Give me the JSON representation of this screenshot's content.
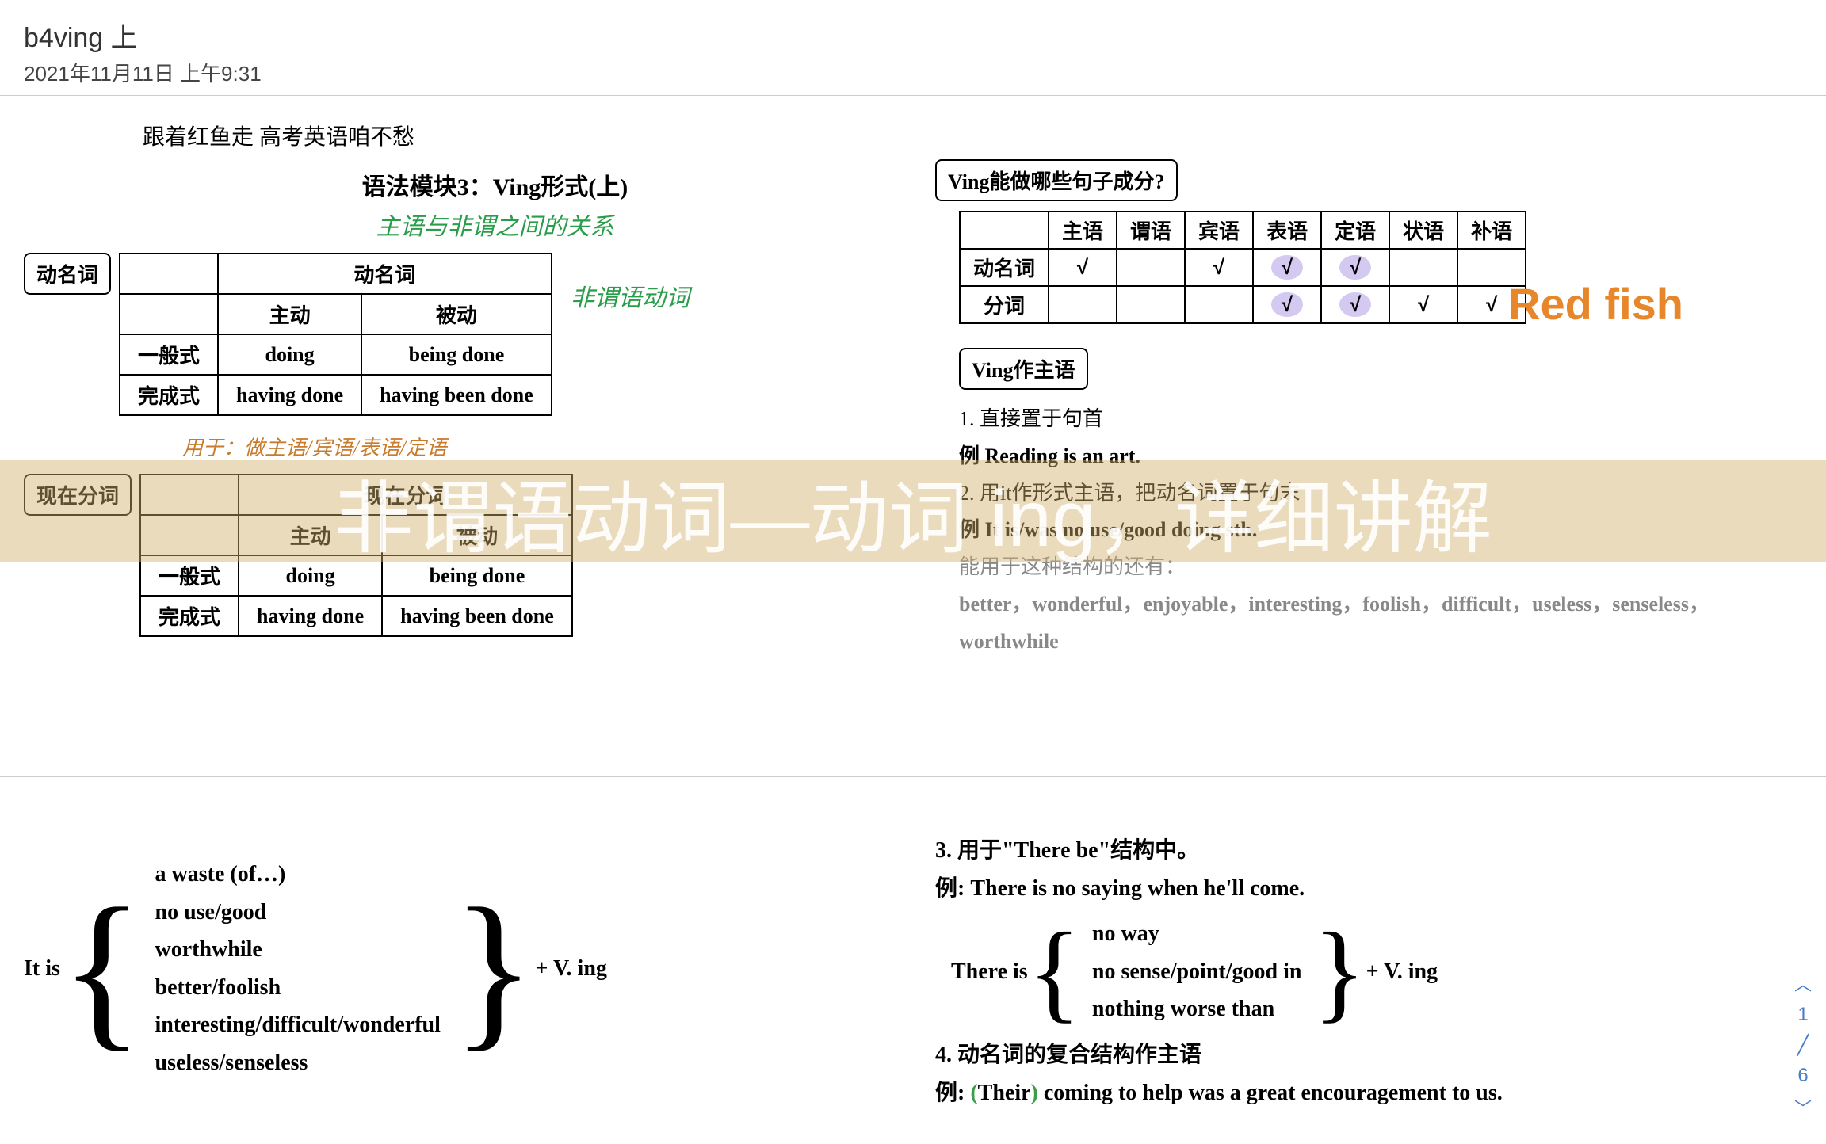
{
  "header": {
    "title": "b4ving 上",
    "date": "2021年11月11日 上午9:31"
  },
  "left": {
    "slogan": "跟着红鱼走  高考英语咱不愁",
    "module_title": "语法模块3：Ving形式(上)",
    "note_nonfinite": "非谓语动词",
    "note_relation": "主语与非谓之间的关系",
    "label_gerund": "动名词",
    "label_participle": "现在分词",
    "tbl1": {
      "header": "动名词",
      "col1": "主动",
      "col2": "被动",
      "row1_label": "一般式",
      "row1_c1": "doing",
      "row1_c2": "being done",
      "row2_label": "完成式",
      "row2_c1": "having done",
      "row2_c2": "having been done"
    },
    "note_orange": "用于：做主语/宾语/表语/定语",
    "tbl2": {
      "header": "现在分词",
      "col1": "主动",
      "col2": "被动",
      "row1_label": "一般式",
      "row1_c1": "doing",
      "row1_c2": "being done",
      "row2_label": "完成式",
      "row2_c1": "having done",
      "row2_c2": "having been done"
    }
  },
  "right": {
    "brand": "Red fish",
    "q_title": "Ving能做哪些句子成分?",
    "roles": {
      "cols": [
        "主语",
        "谓语",
        "宾语",
        "表语",
        "定语",
        "状语",
        "补语"
      ],
      "row1_label": "动名词",
      "row1": [
        "√",
        "",
        "√",
        "√",
        "√",
        "",
        ""
      ],
      "row2_label": "分词",
      "row2": [
        "",
        "",
        "",
        "√",
        "√",
        "√",
        "√"
      ]
    },
    "sub_title": "Ving作主语",
    "rule1": "1. 直接置于句首",
    "rule1_ex": "例  Reading is an art.",
    "rule2": "2. 用it作形式主语，把动名词置于句末",
    "rule2_ex": "例  It is/was no use/good doing sth.",
    "rule_note": "能用于这种结构的还有：",
    "rule_adj": "better，wonderful，enjoyable，interesting，foolish，difficult，useless，senseless，worthwhile"
  },
  "watermark": "非谓语动词—动词 ing，详细讲解",
  "bottom_left": {
    "prefix": "It is",
    "items": [
      "a waste (of…)",
      "no use/good",
      "worthwhile",
      "better/foolish",
      "interesting/difficult/wonderful",
      "useless/senseless"
    ],
    "suffix": "+ V. ing"
  },
  "bottom_right": {
    "rule3": "3. 用于\"There be\"结构中。",
    "rule3_ex": "例: There is no saying when he'll come.",
    "tb_prefix": "There is",
    "tb_items": [
      "no way",
      "no sense/point/good in",
      "nothing worse than"
    ],
    "tb_suffix": "+ V. ing",
    "rule4": "4. 动名词的复合结构作主语",
    "rule4_ex_pre": "例:",
    "rule4_ex_their": "Their",
    "rule4_ex_rest": "coming to help was a great encouragement to us."
  },
  "nav": {
    "up": "︿",
    "page": "1",
    "sep": "╱",
    "total": "6",
    "down": "﹀"
  }
}
